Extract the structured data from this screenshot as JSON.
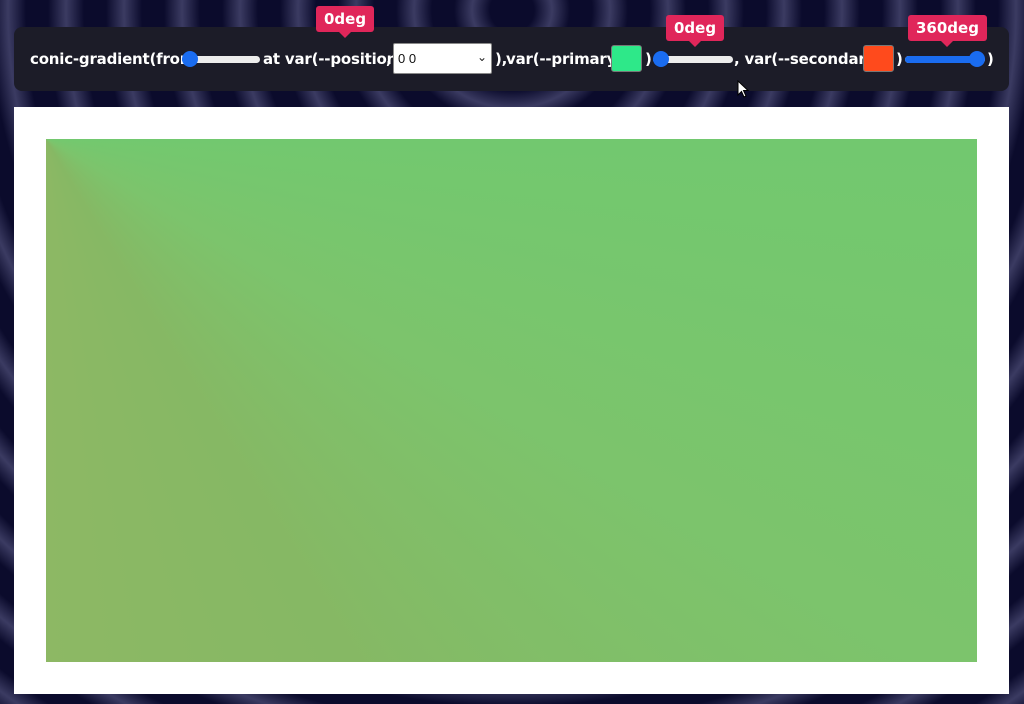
{
  "toolbar": {
    "text_conic": "conic-gradient(from",
    "text_at_var": "at var(--position",
    "comma1": ",",
    "paren_close1": "),",
    "text_var_primary": "var(--primary,",
    "paren_close2": ")",
    "text_var_secondary": ", var(--secondary,",
    "paren_close3": ")",
    "paren_close4": ")",
    "from_angle": {
      "value": "0deg",
      "fraction": 0.0
    },
    "position_select": {
      "value": "0 0"
    },
    "primary_color": "#2ee889",
    "primary_stop": {
      "value": "0deg",
      "fraction": 0.0
    },
    "secondary_color": "#ff4a1c",
    "secondary_stop": {
      "value": "360deg",
      "fraction": 1.0
    }
  },
  "colors": {
    "accent": "#1a6cf0",
    "tooltip": "#e0265a",
    "toolbar_bg": "#1c1c28",
    "preview_green": "#66ce72",
    "preview_orange": "#8db864"
  },
  "icons": {
    "cursor": "mouse-pointer-icon",
    "select_arrow": "chevron-down-icon"
  }
}
